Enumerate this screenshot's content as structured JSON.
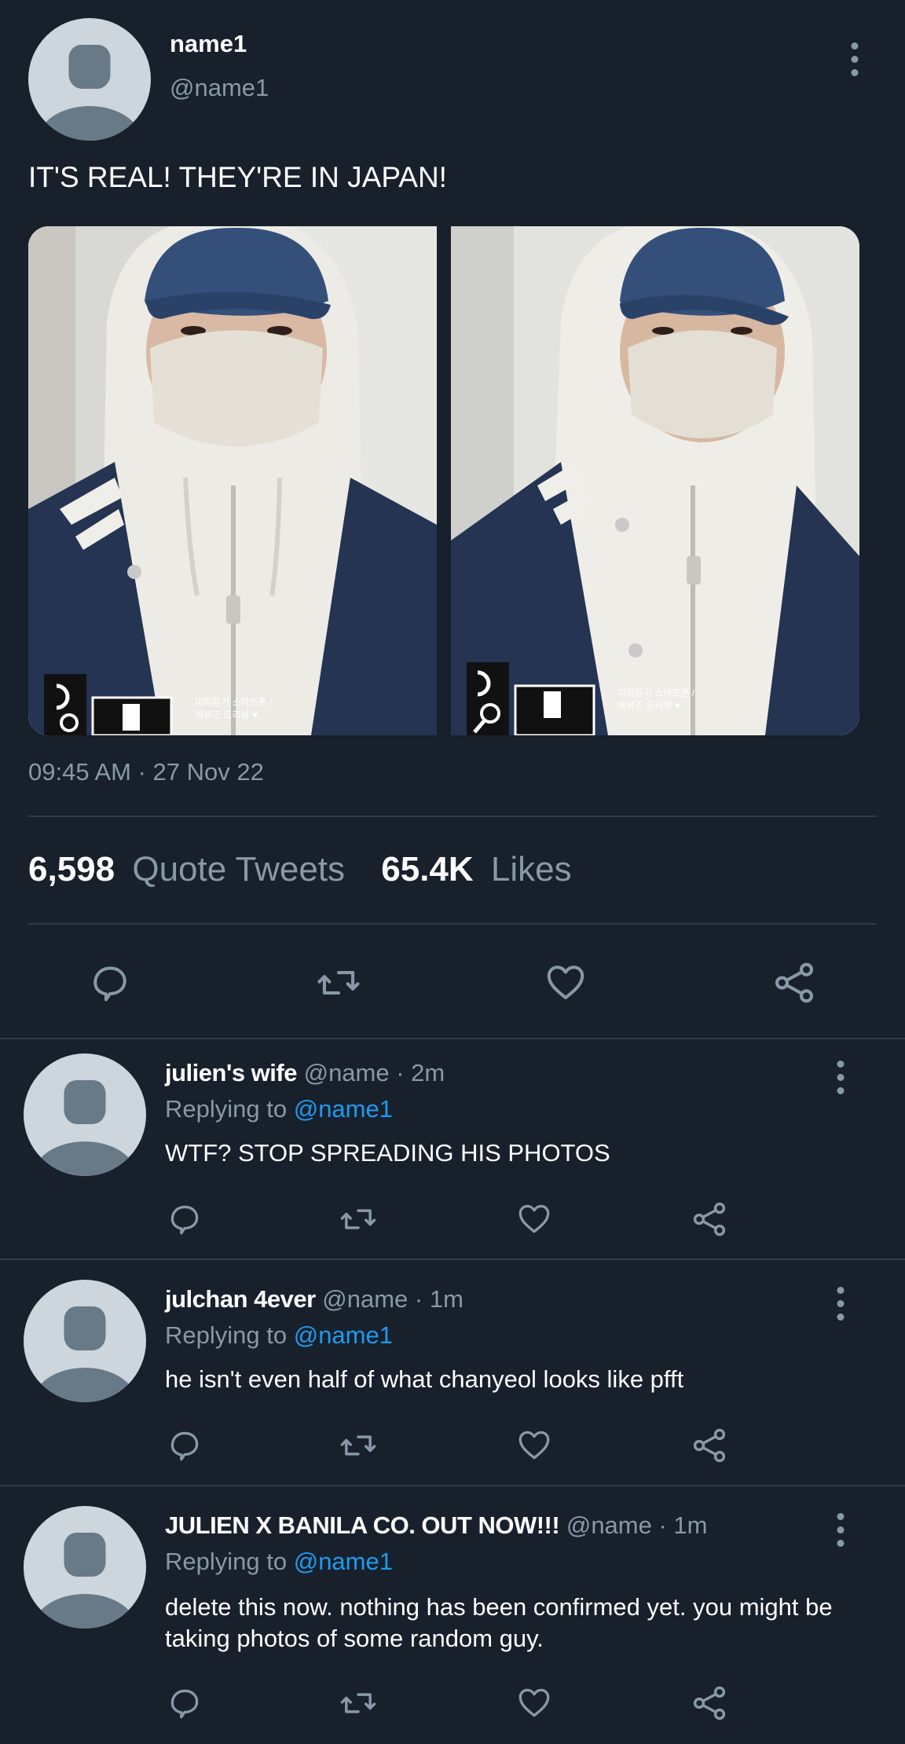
{
  "tweet": {
    "display_name": "name1",
    "handle": "@name1",
    "text": "IT'S REAL! THEY'RE IN JAPAN!",
    "timestamp": "09:45 AM · 27 Nov 22",
    "stats": {
      "quote_tweets_count": "6,598",
      "quote_tweets_label": "Quote Tweets",
      "likes_count": "65.4K",
      "likes_label": "Likes"
    },
    "media": [
      {
        "alt_icon": "photo",
        "watermark": "미리듣기 스마트폰 / 에뷰즈 드리뷰 ♥"
      },
      {
        "alt_icon": "photo",
        "watermark": "미리듣기 스마트폰 / 에뷰즈 드리뷰 ♥"
      }
    ]
  },
  "replies": [
    {
      "display_name": "julien's wife",
      "handle": "@name",
      "time": "· 2m",
      "replying_label": "Replying to",
      "replying_to": "@name1",
      "text": "WTF? STOP SPREADING HIS PHOTOS"
    },
    {
      "display_name": "julchan 4ever",
      "handle": "@name",
      "time": "· 1m",
      "replying_label": "Replying to",
      "replying_to": "@name1",
      "text": "he isn't even half of what chanyeol looks like pfft"
    },
    {
      "display_name": "JULIEN X BANILA CO. OUT NOW!!!",
      "handle": "@name",
      "time": "· 1m",
      "replying_label": "Replying to",
      "replying_to": "@name1",
      "text": "delete this now. nothing has been confirmed yet. you might be taking photos of some random guy."
    }
  ],
  "icons": [
    "reply-icon",
    "retweet-icon",
    "like-icon",
    "share-icon",
    "more-options-icon"
  ],
  "colors": {
    "background": "#17202b",
    "muted_text": "#8899a6",
    "link": "#1d9bf0",
    "divider": "#2f3b47"
  }
}
